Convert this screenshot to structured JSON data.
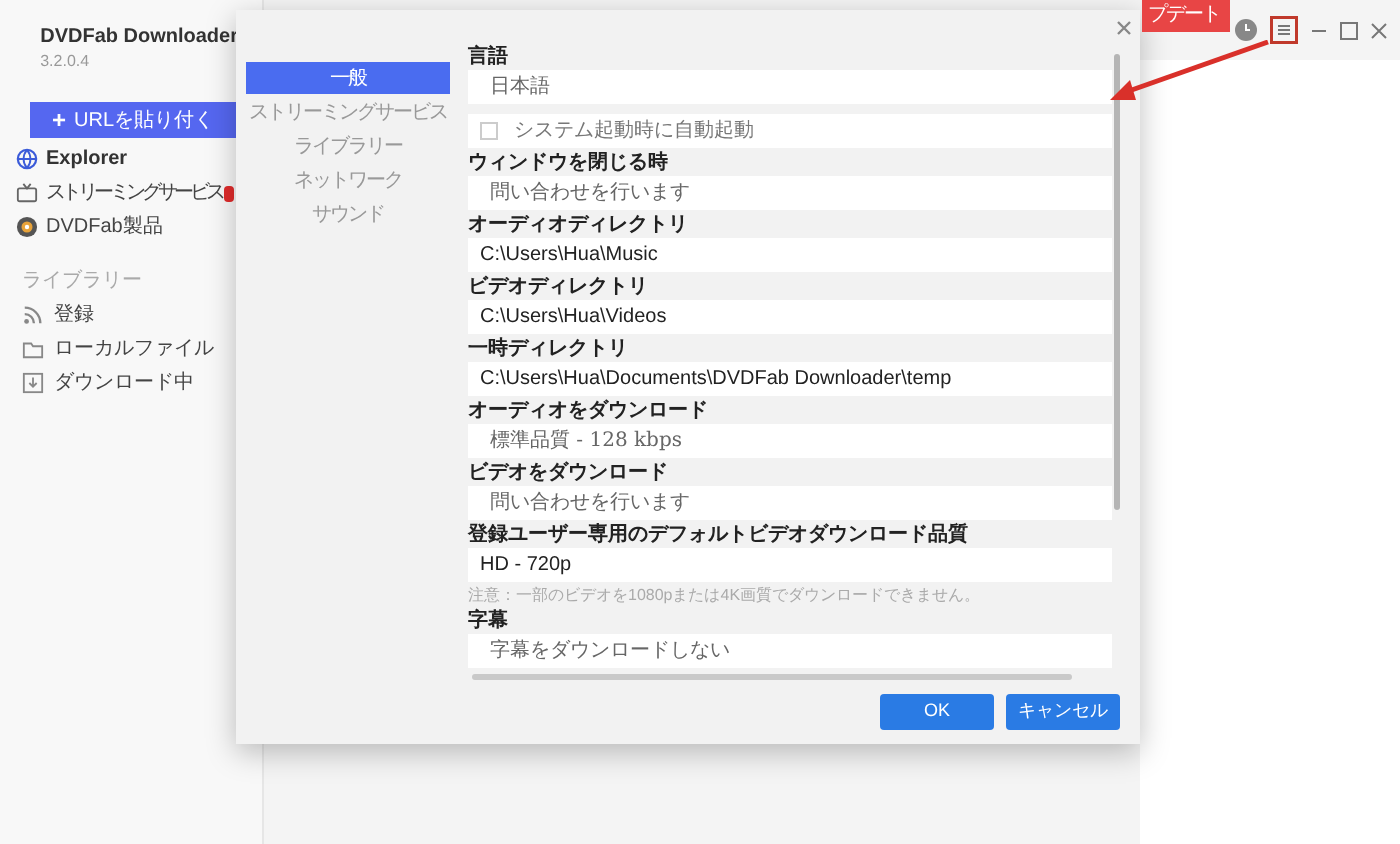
{
  "app": {
    "title": "DVDFab Downloader",
    "version": "3.2.0.4",
    "url_button": {
      "icon": "+",
      "label": "URLを貼り付く"
    },
    "nav": [
      {
        "label": "Explorer",
        "kind": "globe",
        "selected": true,
        "badge": false
      },
      {
        "label": "ストリーミングサービス",
        "kind": "tv",
        "selected": false,
        "badge": true
      },
      {
        "label": "DVDFab製品",
        "kind": "logo",
        "selected": false,
        "badge": false
      }
    ],
    "library_heading": "ライブラリー",
    "library": [
      {
        "label": "登録",
        "kind": "rss"
      },
      {
        "label": "ローカルファイル",
        "kind": "folder"
      },
      {
        "label": "ダウンロード中",
        "kind": "download"
      }
    ],
    "update_button": "プデート"
  },
  "dialog": {
    "tabs": [
      {
        "label": "一般",
        "selected": true
      },
      {
        "label": "ストリーミングサービス",
        "selected": false
      },
      {
        "label": "ライブラリー",
        "selected": false
      },
      {
        "label": "ネットワーク",
        "selected": false
      },
      {
        "label": "サウンド",
        "selected": false
      }
    ],
    "settings": [
      {
        "kind": "select",
        "label": "言語",
        "value": "日本語"
      },
      {
        "kind": "checkbox",
        "label": "システム起動時に自動起動",
        "checked": false
      },
      {
        "kind": "select",
        "label": "ウィンドウを閉じる時",
        "value": "問い合わせを行います"
      },
      {
        "kind": "text",
        "label": "オーディオディレクトリ",
        "value": "C:\\Users\\Hua\\Music"
      },
      {
        "kind": "text",
        "label": "ビデオディレクトリ",
        "value": "C:\\Users\\Hua\\Videos"
      },
      {
        "kind": "text",
        "label": "一時ディレクトリ",
        "value": "C:\\Users\\Hua\\Documents\\DVDFab Downloader\\temp"
      },
      {
        "kind": "select",
        "label": "オーディオをダウンロード",
        "value": "標準品質 - 128 kbps"
      },
      {
        "kind": "select",
        "label": "ビデオをダウンロード",
        "value": "問い合わせを行います"
      },
      {
        "kind": "text",
        "label": "登録ユーザー専用のデフォルトビデオダウンロード品質",
        "value": "HD - 720p",
        "note": "注意：一部のビデオを1080pまたは4K画質でダウンロードできません。"
      },
      {
        "kind": "select",
        "label": "字幕",
        "value": "字幕をダウンロードしない"
      }
    ],
    "buttons": [
      {
        "label": "OK"
      },
      {
        "label": "キャンセル"
      }
    ]
  }
}
